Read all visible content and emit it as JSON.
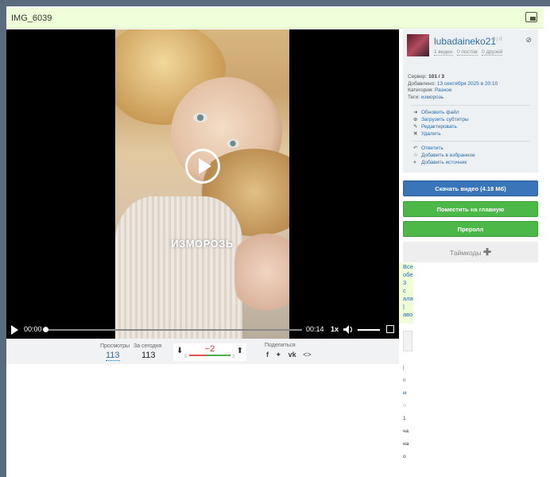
{
  "window": {
    "title": "IMG_6039"
  },
  "video": {
    "overlay_text": "ИЗМОРОЗЬ",
    "time_current": "00:00",
    "time_total": "00:14",
    "speed": "1x",
    "progress": 0
  },
  "stats": {
    "views_label": "Просмотры",
    "views_value": "113",
    "today_label": "За сегодня",
    "today_value": "113",
    "rating_score": "−2",
    "rating_neg_count": "5",
    "rating_pos_count": "3",
    "share_label": "Поделиться",
    "share_icons": [
      "facebook-icon",
      "twitter-icon",
      "vk-icon",
      "embed-icon"
    ]
  },
  "user": {
    "name": "lubadaineko21",
    "karma": "0 | 0",
    "videos": "1 видео",
    "posts": "0 постов",
    "friends": "0 друзей"
  },
  "meta": {
    "server_label": "Сервер:",
    "server_value": "101 / 3",
    "added_label": "Добавлено:",
    "added_value": "13 сентября 2025 в 20:10",
    "category_label": "Категория:",
    "category_value": "Разное",
    "tags_label": "Теги:",
    "tags_value": "изморозь"
  },
  "actions": {
    "update_file": "Обновить файл",
    "upload_subtitles": "Загрузить субтитры",
    "edit": "Редактировать",
    "delete": "Удалить",
    "reply": "Ответить",
    "add_favorite": "Добавить в избранное",
    "add_source": "Добавить источник"
  },
  "buttons": {
    "download": "Скачать видео (4.18 Мб)",
    "place_main": "Поместить на главную",
    "preroll": "Преролл",
    "timecodes": "Таймкоды"
  },
  "sidebox": {
    "lines": [
      "Все",
      "обе",
      "3",
      "с",
      "ала",
      "|",
      "аво"
    ]
  },
  "sidecol": {
    "lines": [
      "|",
      "п",
      "м",
      "○",
      "1",
      "ча",
      "на",
      "о"
    ]
  },
  "colors": {
    "title_bg": "#efffd9",
    "link": "#2a6aa8",
    "download_btn": "#3a75b9",
    "green_btn": "#4cb848",
    "rating_negative": "#c83030"
  }
}
